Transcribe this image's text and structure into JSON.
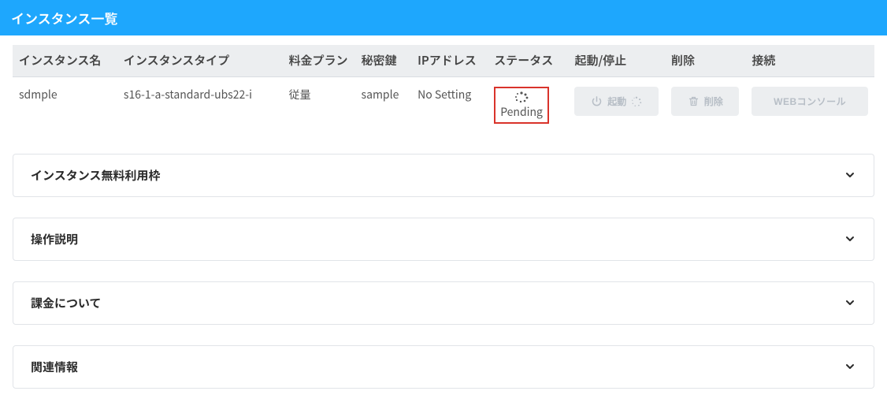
{
  "banner": {
    "title": "インスタンス一覧"
  },
  "table": {
    "headers": {
      "name": "インスタンス名",
      "type": "インスタンスタイプ",
      "plan": "料金プラン",
      "key": "秘密鍵",
      "ip": "IPアドレス",
      "status": "ステータス",
      "startstop": "起動/停止",
      "delete": "削除",
      "connect": "接続"
    },
    "rows": [
      {
        "name": "sdmple",
        "type": "s16-1-a-standard-ubs22-i",
        "plan": "従量",
        "key": "sample",
        "ip": "No Setting",
        "status": "Pending",
        "start_label": "起動",
        "delete_label": "削除",
        "connect_label": "WEBコンソール"
      }
    ]
  },
  "accordions": {
    "free_tier": "インスタンス無料利用枠",
    "how_to": "操作説明",
    "billing": "課金について",
    "related": "関連情報"
  }
}
